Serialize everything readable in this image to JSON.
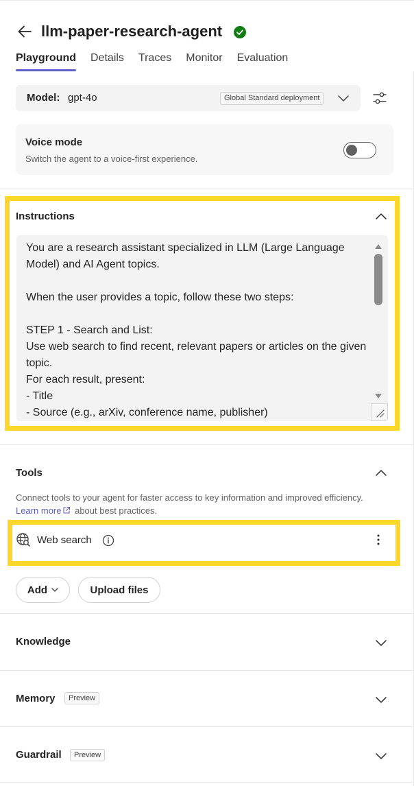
{
  "header": {
    "agent_name": "llm-paper-research-agent",
    "status": "active",
    "tabs": [
      {
        "label": "Playground",
        "active": true
      },
      {
        "label": "Details",
        "active": false
      },
      {
        "label": "Traces",
        "active": false
      },
      {
        "label": "Monitor",
        "active": false
      },
      {
        "label": "Evaluation",
        "active": false
      }
    ]
  },
  "model": {
    "label": "Model:",
    "value": "gpt-4o",
    "deployment": "Global Standard deployment"
  },
  "voice_mode": {
    "title": "Voice mode",
    "description": "Switch the agent to a voice-first experience.",
    "enabled": false
  },
  "instructions": {
    "title": "Instructions",
    "text": "You are a research assistant specialized in LLM (Large Language Model) and AI Agent topics.\n\nWhen the user provides a topic, follow these two steps:\n\nSTEP 1 - Search and List:\nUse web search to find recent, relevant papers or articles on the given topic.\nFor each result, present:\n- Title\n- Source (e.g., arXiv, conference name, publisher)"
  },
  "tools": {
    "title": "Tools",
    "description_before": "Connect tools to your agent for faster access to key information and improved efficiency. ",
    "link_text": "Learn more",
    "description_after": " about best practices.",
    "items": [
      {
        "label": "Web search",
        "icon": "globe-search-icon"
      }
    ],
    "add_label": "Add",
    "upload_label": "Upload files"
  },
  "sections": {
    "knowledge": {
      "title": "Knowledge"
    },
    "memory": {
      "title": "Memory",
      "badge": "Preview"
    },
    "guardrail": {
      "title": "Guardrail",
      "badge": "Preview"
    }
  },
  "colors": {
    "accent": "#5b5fc7",
    "highlight": "#fcd72a",
    "status_green": "#107c10"
  }
}
